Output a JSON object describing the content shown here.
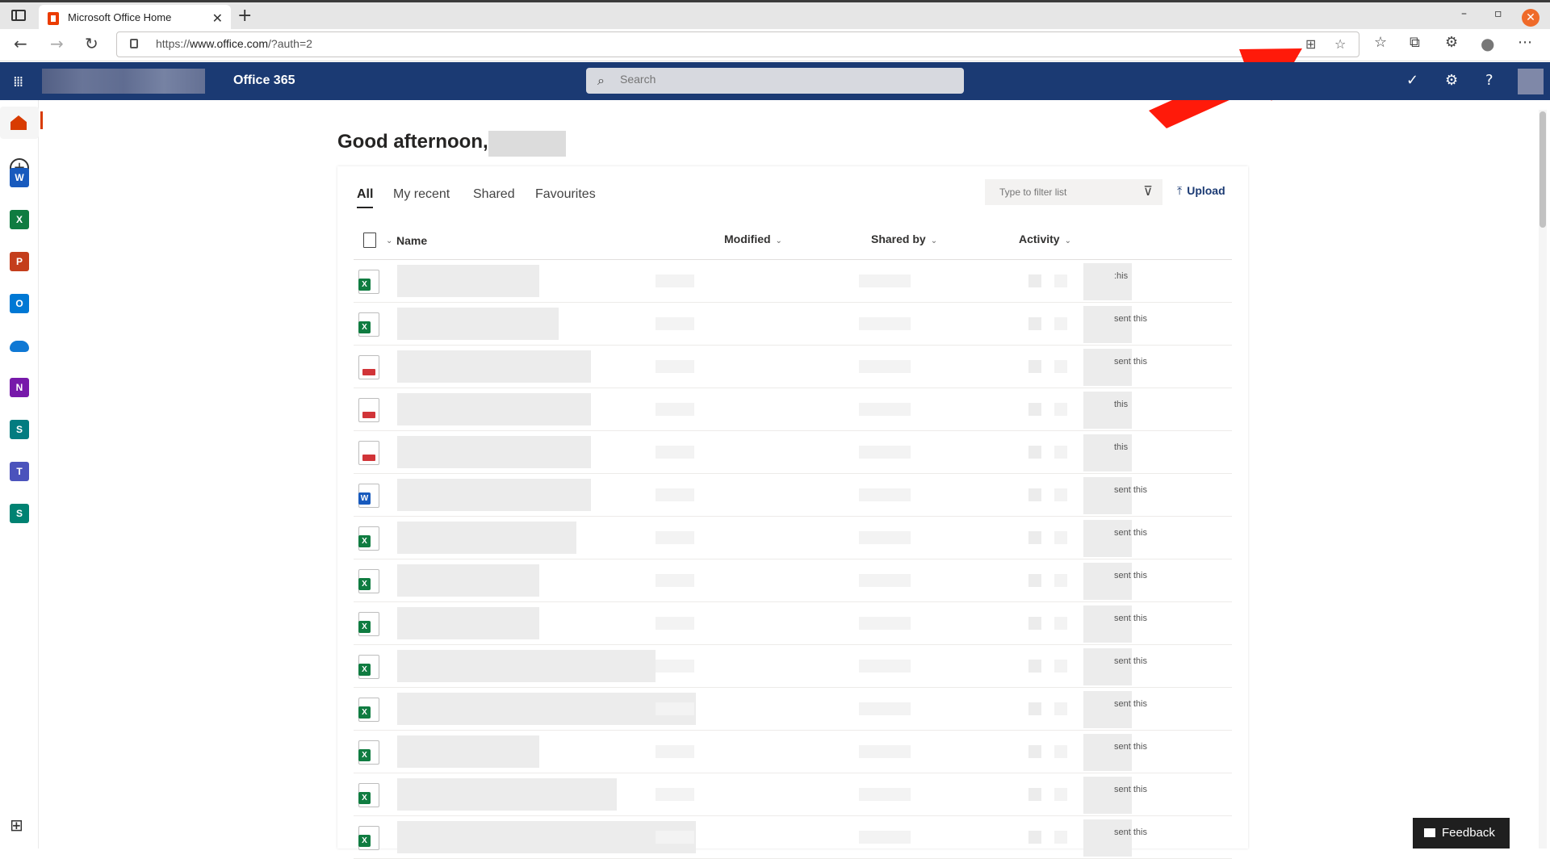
{
  "browser": {
    "tab_title": "Microsoft Office Home",
    "new_tab_label": "+",
    "tab_close_label": "✕",
    "minimize_label": "–",
    "maximize_label": "▫",
    "close_label": "✕",
    "url_prefix": "https://",
    "url_domain": "www.office.com",
    "url_path": "/?auth=2"
  },
  "suite": {
    "title": "Office 365",
    "search_placeholder": "Search"
  },
  "rail": {
    "apps": [
      {
        "name": "Word",
        "letter": "W",
        "color": "#185abd"
      },
      {
        "name": "Excel",
        "letter": "X",
        "color": "#107c41"
      },
      {
        "name": "PowerPoint",
        "letter": "P",
        "color": "#c43e1c"
      },
      {
        "name": "Outlook",
        "letter": "O",
        "color": "#0078d4"
      },
      {
        "name": "OneDrive",
        "letter": "",
        "color": "#0f78d4"
      },
      {
        "name": "OneNote",
        "letter": "N",
        "color": "#7719aa"
      },
      {
        "name": "SharePoint",
        "letter": "S",
        "color": "#037c80"
      },
      {
        "name": "Teams",
        "letter": "T",
        "color": "#4b53bc"
      },
      {
        "name": "Sway",
        "letter": "S",
        "color": "#008272"
      }
    ]
  },
  "main": {
    "greeting": "Good afternoon,",
    "tabs": [
      "All",
      "My recent",
      "Shared",
      "Favourites"
    ],
    "filter_placeholder": "Type to filter list",
    "upload_label": "Upload",
    "columns": {
      "name": "Name",
      "modified": "Modified",
      "shared_by": "Shared by",
      "activity": "Activity"
    },
    "files": [
      {
        "type": "excel",
        "activity": ":his"
      },
      {
        "type": "excel",
        "activity": "sent this"
      },
      {
        "type": "pdf",
        "activity": "sent this"
      },
      {
        "type": "pdf",
        "activity": "this"
      },
      {
        "type": "pdf",
        "activity": "this"
      },
      {
        "type": "word",
        "activity": "sent this"
      },
      {
        "type": "excel",
        "activity": "sent this"
      },
      {
        "type": "excel",
        "activity": "sent this"
      },
      {
        "type": "excel",
        "activity": "sent this"
      },
      {
        "type": "excel",
        "activity": "sent this"
      },
      {
        "type": "excel",
        "activity": "sent this"
      },
      {
        "type": "excel",
        "activity": "sent this"
      },
      {
        "type": "excel",
        "activity": "sent this"
      },
      {
        "type": "excel",
        "activity": "sent this"
      }
    ]
  },
  "feedback_label": "Feedback",
  "colors": {
    "suite_bar": "#1b3a73",
    "excel": "#107c41",
    "word": "#185abd",
    "pdf": "#d13438",
    "annotation_arrow": "#ff1a0a"
  }
}
